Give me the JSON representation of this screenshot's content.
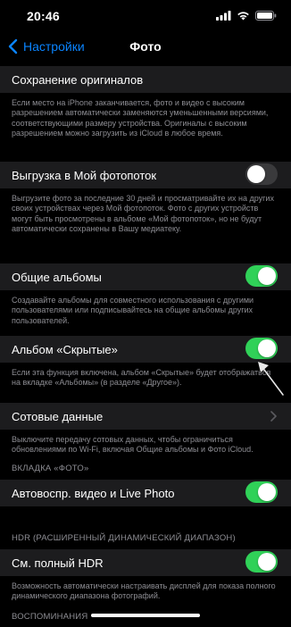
{
  "status_bar": {
    "time": "20:46"
  },
  "nav": {
    "back_label": "Настройки",
    "title": "Фото"
  },
  "sections": {
    "originals": {
      "label": "Сохранение оригиналов",
      "footer": "Если место на iPhone заканчивается, фото и видео с высоким разрешением автоматически заменяются уменьшенными версиями, соответствующими размеру устройства. Оригиналы с высоким разрешением можно загрузить из iCloud в любое время."
    },
    "photostream": {
      "label": "Выгрузка в Мой фотопоток",
      "toggle": "off",
      "footer": "Выгрузите фото за последние 30 дней и просматривайте их на других своих устройствах через Мой фотопоток. Фото с других устройств могут быть просмотрены в альбоме «Мой фотопоток», но не будут автоматически сохранены в Вашу медиатеку."
    },
    "shared": {
      "label": "Общие альбомы",
      "toggle": "on",
      "footer": "Создавайте альбомы для совместного использования с другими пользователями или подписывайтесь на общие альбомы других пользователей."
    },
    "hidden": {
      "label": "Альбом «Скрытые»",
      "toggle": "on",
      "footer": "Если эта функция включена, альбом «Скрытые» будет отображаться на вкладке «Альбомы» (в разделе «Другое»)."
    },
    "cellular": {
      "label": "Сотовые данные",
      "footer": "Выключите передачу сотовых данных, чтобы ограничиться обновлениями по Wi-Fi, включая Общие альбомы и Фото iCloud."
    },
    "photos_tab": {
      "header": "ВКЛАДКА «ФОТО»",
      "label": "Автовоспр. видео и Live Photo",
      "toggle": "on"
    },
    "hdr": {
      "header": "HDR (РАСШИРЕННЫЙ ДИНАМИЧЕСКИЙ ДИАПАЗОН)",
      "label": "См. полный HDR",
      "toggle": "on",
      "footer": "Возможность автоматически настраивать дисплей для показа полного динамического диапазона фотографий."
    },
    "memories": {
      "header": "ВОСПОМИНАНИЯ"
    }
  },
  "colors": {
    "accent": "#0a84ff",
    "toggle_on": "#30d158",
    "toggle_off": "#3a3a3c",
    "cell_bg": "#1c1c1e",
    "secondary_text": "#8d8d93"
  },
  "icons": [
    "chevron-left-icon",
    "signal-icon",
    "wifi-icon",
    "battery-icon",
    "chevron-right-icon"
  ]
}
